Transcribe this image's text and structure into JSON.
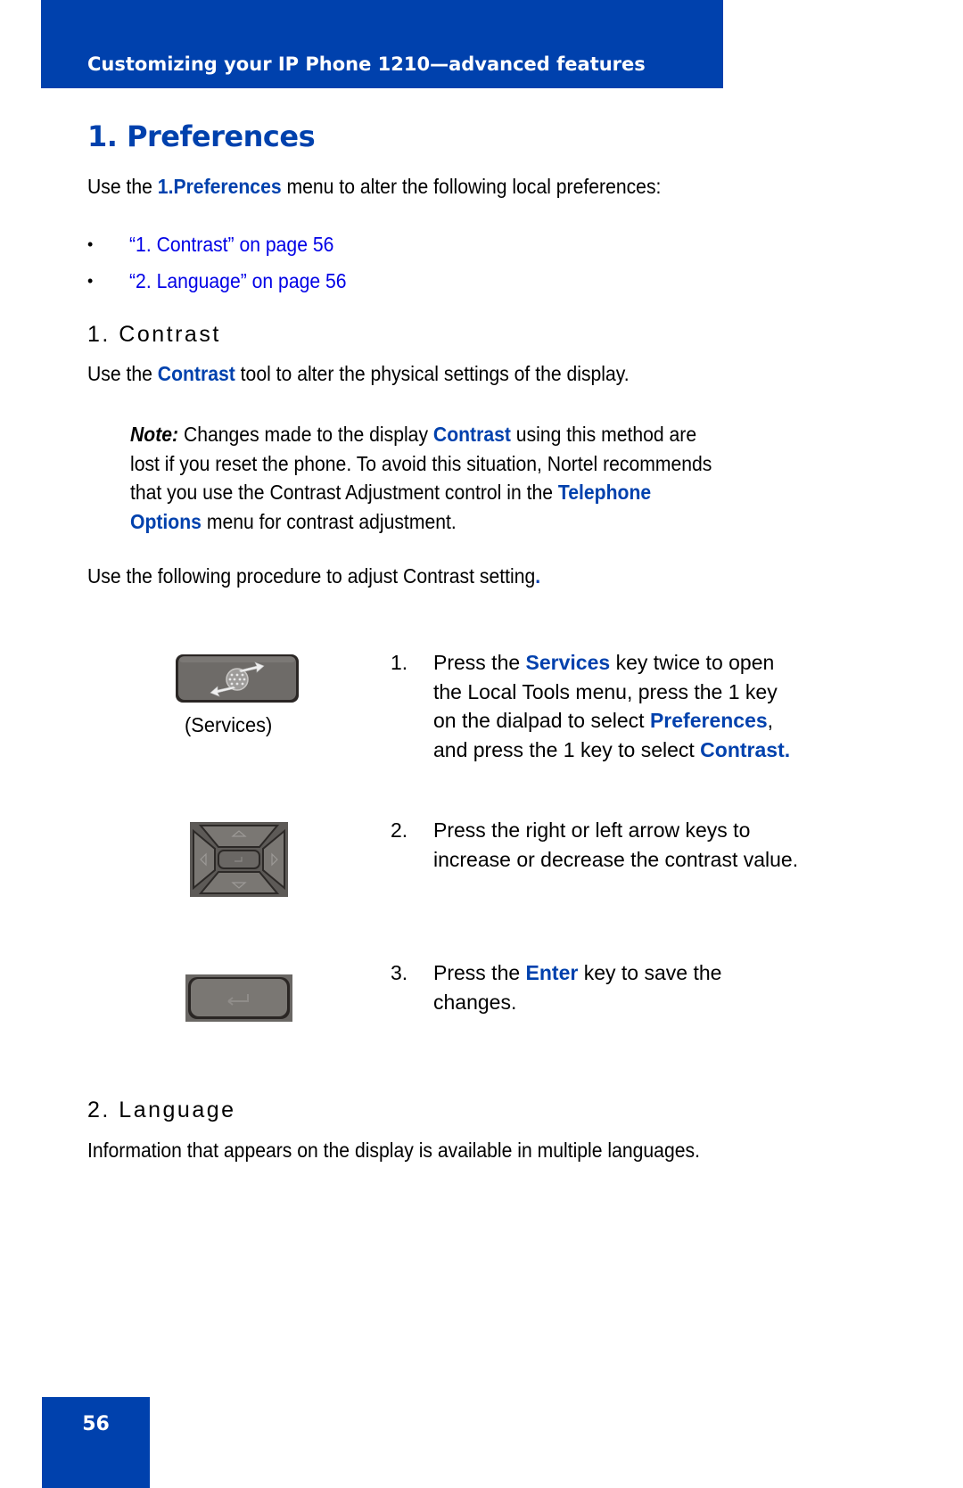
{
  "header": {
    "title": "Customizing your IP Phone 1210—advanced features"
  },
  "page_title": "1. Preferences",
  "intro": {
    "prefix": "Use the ",
    "emphasis": "1.Preferences",
    "suffix": " menu to alter the following local preferences:"
  },
  "links": [
    {
      "bullet": "•",
      "label": "“1. Contrast” on page 56"
    },
    {
      "bullet": "•",
      "label": "“2. Language” on page 56"
    }
  ],
  "contrast": {
    "heading": "1. Contrast",
    "desc_prefix": "Use the ",
    "desc_emphasis": "Contrast",
    "desc_suffix": " tool to alter the physical settings of the display.",
    "note": {
      "label": "Note:",
      "line1_a": " Changes made to the display ",
      "line1_em": "Contrast",
      "line1_b": " using this method are",
      "line2": "lost if you reset the phone. To avoid this situation, Nortel recommends",
      "line3_a": "that you use the Contrast Adjustment control in the ",
      "line3_em": "Telephone",
      "line4_em": "Options",
      "line4_b": " menu for contrast adjustment."
    },
    "procedure_intro": "Use the following procedure to adjust Contrast setting",
    "procedure_intro_end": ".",
    "services_caption": "(Services)",
    "steps": [
      {
        "num": "1.",
        "l1_a": "Press the ",
        "l1_em": "Services",
        "l1_b": " key twice to open",
        "l2": "the Local Tools menu, press the 1 key",
        "l3_a": "on the dialpad to select ",
        "l3_em": "Preferences",
        "l3_b": ",",
        "l4_a": "and press the 1 key to select ",
        "l4_em": "Contrast."
      },
      {
        "num": "2.",
        "l1": "Press the right or left arrow keys to",
        "l2": "increase or decrease the contrast value."
      },
      {
        "num": "3.",
        "l1_a": "Press the ",
        "l1_em": "Enter",
        "l1_b": " key to save the",
        "l2": "changes."
      }
    ]
  },
  "language": {
    "heading": "2. Language",
    "desc": "Information that appears on the display is available in multiple languages."
  },
  "footer": {
    "page_number": "56"
  },
  "colors": {
    "brand_blue": "#0041ad",
    "link_blue": "#0000e6",
    "key_gray": "#6e6b68"
  }
}
